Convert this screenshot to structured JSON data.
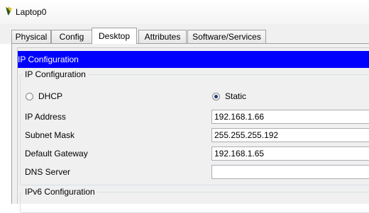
{
  "window": {
    "title": "Laptop0",
    "icon": "laptop-app-icon"
  },
  "tabs": [
    {
      "label": "Physical",
      "active": false
    },
    {
      "label": "Config",
      "active": false
    },
    {
      "label": "Desktop",
      "active": true
    },
    {
      "label": "Attributes",
      "active": false
    },
    {
      "label": "Software/Services",
      "active": false
    }
  ],
  "app_header": "IP Configuration",
  "ip_config": {
    "group_title": "IP Configuration",
    "mode_options": [
      {
        "label": "DHCP",
        "selected": false
      },
      {
        "label": "Static",
        "selected": true
      }
    ],
    "fields": [
      {
        "label": "IP Address",
        "value": "192.168.1.66"
      },
      {
        "label": "Subnet Mask",
        "value": "255.255.255.192"
      },
      {
        "label": "Default Gateway",
        "value": "192.168.1.65"
      },
      {
        "label": "DNS Server",
        "value": ""
      }
    ]
  },
  "ipv6_config": {
    "group_title": "IPv6 Configuration"
  },
  "colors": {
    "header_bg": "#0000ff",
    "header_text": "#ffffff",
    "panel_bg": "#f0f0f0"
  }
}
